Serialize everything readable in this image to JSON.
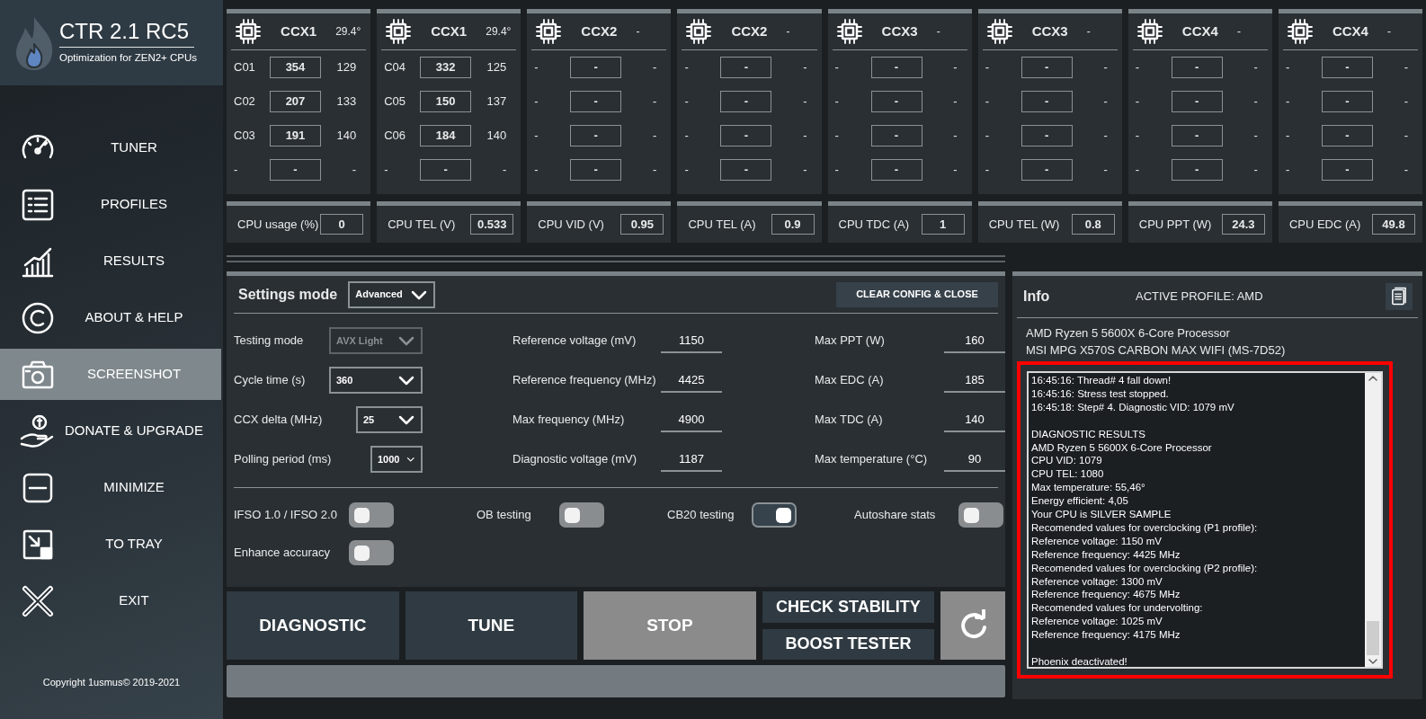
{
  "app": {
    "title": "CTR 2.1 RC5",
    "subtitle": "Optimization for ZEN2+ CPUs",
    "copyright": "Copyright 1usmus© 2019-2021"
  },
  "sidebar": {
    "items": [
      {
        "label": "TUNER",
        "selected": false
      },
      {
        "label": "PROFILES",
        "selected": false
      },
      {
        "label": "RESULTS",
        "selected": false
      },
      {
        "label": "ABOUT & HELP",
        "selected": false
      },
      {
        "label": "SCREENSHOT",
        "selected": true
      },
      {
        "label": "DONATE & UPGRADE",
        "selected": false
      },
      {
        "label": "MINIMIZE",
        "selected": false
      },
      {
        "label": "TO TRAY",
        "selected": false
      },
      {
        "label": "EXIT",
        "selected": false
      }
    ]
  },
  "ccx": [
    {
      "name": "CCX1",
      "temp": "29.4°",
      "cores": [
        {
          "label": "C01",
          "value": "354",
          "freq": "129"
        },
        {
          "label": "C02",
          "value": "207",
          "freq": "133"
        },
        {
          "label": "C03",
          "value": "191",
          "freq": "140"
        },
        {
          "label": "-",
          "value": "-",
          "freq": "-"
        }
      ]
    },
    {
      "name": "CCX1",
      "temp": "29.4°",
      "cores": [
        {
          "label": "C04",
          "value": "332",
          "freq": "125"
        },
        {
          "label": "C05",
          "value": "150",
          "freq": "137"
        },
        {
          "label": "C06",
          "value": "184",
          "freq": "140"
        },
        {
          "label": "-",
          "value": "-",
          "freq": "-"
        }
      ]
    },
    {
      "name": "CCX2",
      "temp": "-",
      "cores": [
        {
          "label": "-",
          "value": "-",
          "freq": "-"
        },
        {
          "label": "-",
          "value": "-",
          "freq": "-"
        },
        {
          "label": "-",
          "value": "-",
          "freq": "-"
        },
        {
          "label": "-",
          "value": "-",
          "freq": "-"
        }
      ]
    },
    {
      "name": "CCX2",
      "temp": "-",
      "cores": [
        {
          "label": "-",
          "value": "-",
          "freq": "-"
        },
        {
          "label": "-",
          "value": "-",
          "freq": "-"
        },
        {
          "label": "-",
          "value": "-",
          "freq": "-"
        },
        {
          "label": "-",
          "value": "-",
          "freq": "-"
        }
      ]
    },
    {
      "name": "CCX3",
      "temp": "-",
      "cores": [
        {
          "label": "-",
          "value": "-",
          "freq": "-"
        },
        {
          "label": "-",
          "value": "-",
          "freq": "-"
        },
        {
          "label": "-",
          "value": "-",
          "freq": "-"
        },
        {
          "label": "-",
          "value": "-",
          "freq": "-"
        }
      ]
    },
    {
      "name": "CCX3",
      "temp": "-",
      "cores": [
        {
          "label": "-",
          "value": "-",
          "freq": "-"
        },
        {
          "label": "-",
          "value": "-",
          "freq": "-"
        },
        {
          "label": "-",
          "value": "-",
          "freq": "-"
        },
        {
          "label": "-",
          "value": "-",
          "freq": "-"
        }
      ]
    },
    {
      "name": "CCX4",
      "temp": "-",
      "cores": [
        {
          "label": "-",
          "value": "-",
          "freq": "-"
        },
        {
          "label": "-",
          "value": "-",
          "freq": "-"
        },
        {
          "label": "-",
          "value": "-",
          "freq": "-"
        },
        {
          "label": "-",
          "value": "-",
          "freq": "-"
        }
      ]
    },
    {
      "name": "CCX4",
      "temp": "-",
      "cores": [
        {
          "label": "-",
          "value": "-",
          "freq": "-"
        },
        {
          "label": "-",
          "value": "-",
          "freq": "-"
        },
        {
          "label": "-",
          "value": "-",
          "freq": "-"
        },
        {
          "label": "-",
          "value": "-",
          "freq": "-"
        }
      ]
    }
  ],
  "sensors": [
    {
      "label": "CPU usage (%)",
      "value": "0"
    },
    {
      "label": "CPU TEL (V)",
      "value": "0.533"
    },
    {
      "label": "CPU VID (V)",
      "value": "0.95"
    },
    {
      "label": "CPU TEL (A)",
      "value": "0.9"
    },
    {
      "label": "CPU TDC (A)",
      "value": "1"
    },
    {
      "label": "CPU TEL (W)",
      "value": "0.8"
    },
    {
      "label": "CPU PPT (W)",
      "value": "24.3"
    },
    {
      "label": "CPU EDC (A)",
      "value": "49.8"
    }
  ],
  "settings": {
    "title": "Settings mode",
    "mode": "Advanced",
    "clear_button": "CLEAR CONFIG & CLOSE",
    "selects": [
      {
        "label": "Testing mode",
        "value": "AVX Light",
        "disabled": true
      },
      {
        "label": "Cycle time (s)",
        "value": "360",
        "disabled": false
      },
      {
        "label": "CCX delta (MHz)",
        "value": "25",
        "disabled": false
      },
      {
        "label": "Polling period (ms)",
        "value": "1000",
        "disabled": false
      }
    ],
    "fields_middle": [
      {
        "label": "Reference voltage (mV)",
        "value": "1150"
      },
      {
        "label": "Reference frequency (MHz)",
        "value": "4425"
      },
      {
        "label": "Max frequency (MHz)",
        "value": "4900"
      },
      {
        "label": "Diagnostic voltage (mV)",
        "value": "1187"
      }
    ],
    "fields_right": [
      {
        "label": "Max PPT (W)",
        "value": "160"
      },
      {
        "label": "Max EDC (A)",
        "value": "185"
      },
      {
        "label": "Max TDC (A)",
        "value": "140"
      },
      {
        "label": "Max temperature (°C)",
        "value": "90"
      }
    ],
    "toggles": [
      {
        "label": "IFSO 1.0 / IFSO 2.0",
        "on": false
      },
      {
        "label": "OB testing",
        "on": false
      },
      {
        "label": "CB20 testing",
        "on": true
      },
      {
        "label": "Autoshare stats",
        "on": false
      },
      {
        "label": "Enhance accuracy",
        "on": false
      }
    ]
  },
  "actions": [
    {
      "kind": "big",
      "label": "DIAGNOSTIC",
      "disabled": false
    },
    {
      "kind": "big",
      "label": "TUNE",
      "disabled": false
    },
    {
      "kind": "big",
      "label": "STOP",
      "disabled": true
    },
    {
      "kind": "small",
      "label": "CHECK STABILITY"
    },
    {
      "kind": "small",
      "label": "BOOST TESTER"
    },
    {
      "kind": "icon"
    }
  ],
  "progress": {
    "level": 0
  },
  "info": {
    "title": "Info",
    "active_profile": "ACTIVE PROFILE: AMD",
    "cpu": "AMD Ryzen 5 5600X 6-Core Processor",
    "board": "MSI MPG X570S CARBON MAX WIFI (MS-7D52)",
    "highlighted": true,
    "log_blocks": [
      [
        "16:45:16: Thread# 4 fall down!",
        "16:45:16: Stress test stopped.",
        "16:45:18: Step# 4. Diagnostic VID: 1079 mV"
      ],
      [
        "DIAGNOSTIC RESULTS",
        "AMD Ryzen 5 5600X 6-Core Processor",
        "CPU VID: 1079",
        "CPU TEL: 1080",
        "Max temperature: 55,46°",
        "Energy efficient: 4,05",
        "Your CPU is SILVER SAMPLE",
        "Recomended values for overclocking (P1 profile):",
        "Reference voltage: 1150 mV",
        "Reference frequency: 4425 MHz",
        "Recomended values for overclocking (P2 profile):",
        "Reference voltage: 1300 mV",
        "Reference frequency: 4675 MHz",
        "Recomended values for undervolting:",
        "Reference voltage: 1025 mV",
        "Reference frequency: 4175 MHz"
      ],
      [
        "Phoenix deactivated!"
      ]
    ]
  }
}
